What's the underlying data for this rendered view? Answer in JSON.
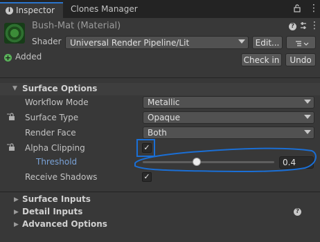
{
  "tabs": {
    "inspector_label": "Inspector",
    "clones_label": "Clones Manager",
    "inspector_icon": "info-icon",
    "lock_icon": "lock-icon",
    "menu_icon": "kebab-menu-icon"
  },
  "material": {
    "title": "Bush-Mat (Material)",
    "help_icon": "help-icon",
    "settings_icon": "sliders-icon",
    "menu_icon": "kebab-menu-icon"
  },
  "shader": {
    "label": "Shader",
    "value": "Universal Render Pipeline/Lit",
    "edit_label": "Edit...",
    "list_icon": "list-icon"
  },
  "vcs": {
    "added_label": "Added",
    "checkin_label": "Check in",
    "undo_label": "Undo"
  },
  "surface_options": {
    "title": "Surface Options",
    "workflow_mode": {
      "label": "Workflow Mode",
      "value": "Metallic"
    },
    "surface_type": {
      "label": "Surface Type",
      "value": "Opaque"
    },
    "render_face": {
      "label": "Render Face",
      "value": "Both"
    },
    "alpha_clipping": {
      "label": "Alpha Clipping",
      "checked": true
    },
    "threshold": {
      "label": "Threshold",
      "value": "0.4",
      "fraction": 0.4
    },
    "receive_shadows": {
      "label": "Receive Shadows",
      "checked": true
    }
  },
  "sections": {
    "surface_inputs": "Surface Inputs",
    "detail_inputs": "Detail Inputs",
    "advanced_options": "Advanced Options"
  },
  "colors": {
    "annotation": "#1a6fd6",
    "accent": "#2a74cc",
    "threshold_label": "#7aa3d8"
  }
}
